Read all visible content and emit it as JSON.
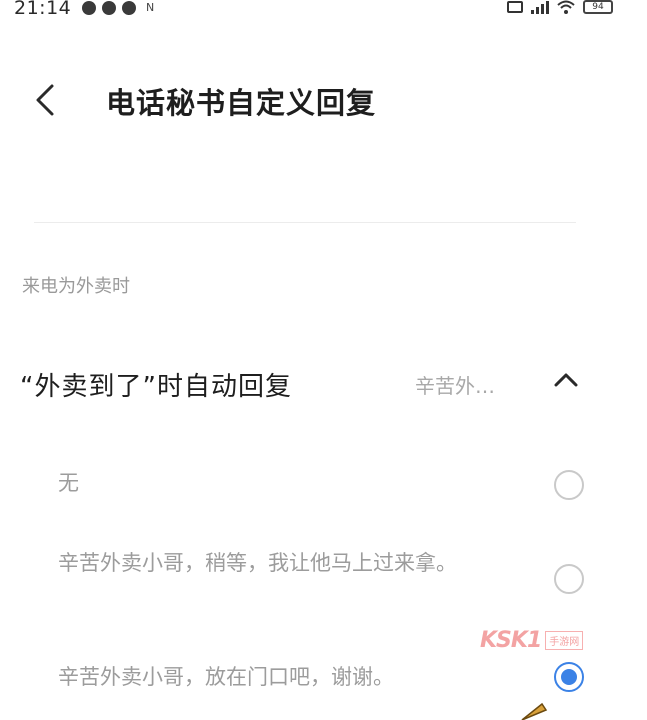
{
  "status_bar": {
    "time": "21:14",
    "notify_n": "N",
    "battery": "94"
  },
  "header": {
    "title": "电话秘书自定义回复"
  },
  "section": {
    "label": "来电为外卖时"
  },
  "setting": {
    "title": "“外卖到了”时自动回复",
    "value": "辛苦外…",
    "expanded": true
  },
  "options": [
    {
      "label": "无",
      "selected": false
    },
    {
      "label": "辛苦外卖小哥，稍等，我让他马上过来拿。",
      "selected": false
    },
    {
      "label": "辛苦外卖小哥，放在门口吧，谢谢。",
      "selected": true
    }
  ],
  "watermark": {
    "text": "KSK1",
    "sub": "手游网"
  },
  "colors": {
    "accent": "#3b82e6",
    "secondary_text": "#9c9c9c"
  }
}
